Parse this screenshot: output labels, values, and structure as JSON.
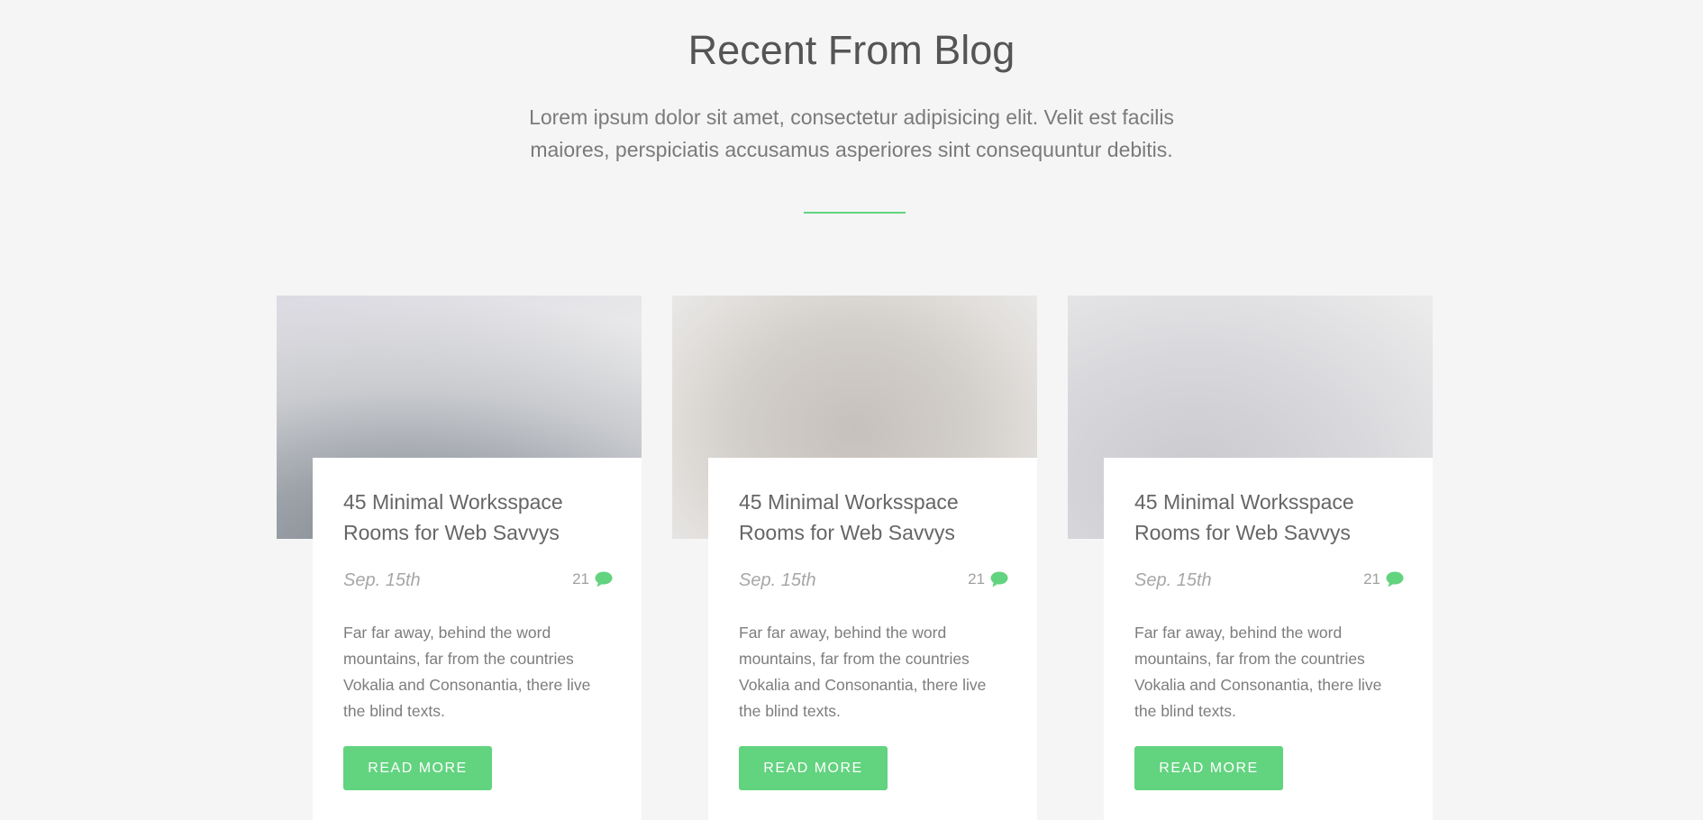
{
  "header": {
    "title": "Recent From Blog",
    "intro": "Lorem ipsum dolor sit amet, consectetur adipisicing elit. Velit est facilis maiores, perspiciatis accusamus asperiores sint consequuntur debitis."
  },
  "colors": {
    "accent": "#62d37f",
    "background": "#f5f5f5",
    "card": "#ffffff"
  },
  "posts": [
    {
      "title": "45 Minimal Worksspace Rooms for Web Savvys",
      "date": "Sep. 15th",
      "comments": "21",
      "comment_icon": "speech-bubble-icon",
      "excerpt": "Far far away, behind the word mountains, far from the countries Vokalia and Consonantia, there live the blind texts.",
      "button": "READ MORE"
    },
    {
      "title": "45 Minimal Worksspace Rooms for Web Savvys",
      "date": "Sep. 15th",
      "comments": "21",
      "comment_icon": "speech-bubble-icon",
      "excerpt": "Far far away, behind the word mountains, far from the countries Vokalia and Consonantia, there live the blind texts.",
      "button": "READ MORE"
    },
    {
      "title": "45 Minimal Worksspace Rooms for Web Savvys",
      "date": "Sep. 15th",
      "comments": "21",
      "comment_icon": "speech-bubble-icon",
      "excerpt": "Far far away, behind the word mountains, far from the countries Vokalia and Consonantia, there live the blind texts.",
      "button": "READ MORE"
    }
  ]
}
